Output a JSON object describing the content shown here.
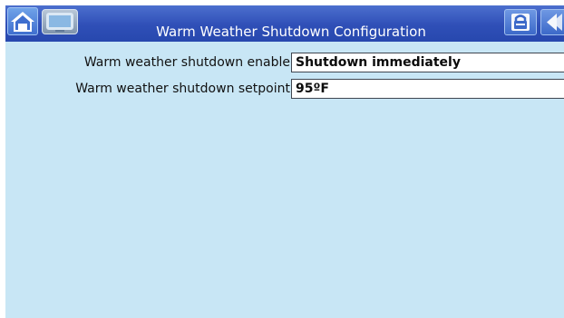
{
  "window": {
    "title": "Warm Weather Shutdown Configuration"
  },
  "toolbar": {
    "home_icon": "home-icon",
    "display_icon": "monitor-icon",
    "lock_icon": "lock-icon",
    "back_icon": "back-icon"
  },
  "settings": [
    {
      "label": "Warm weather shutdown enable",
      "value": "Shutdown immediately"
    },
    {
      "label": "Warm weather shutdown setpoint",
      "value": "95ºF"
    }
  ],
  "colors": {
    "title_bar": "#2f4fb7",
    "background": "#c8e6f5",
    "field_border": "#3f4650"
  }
}
